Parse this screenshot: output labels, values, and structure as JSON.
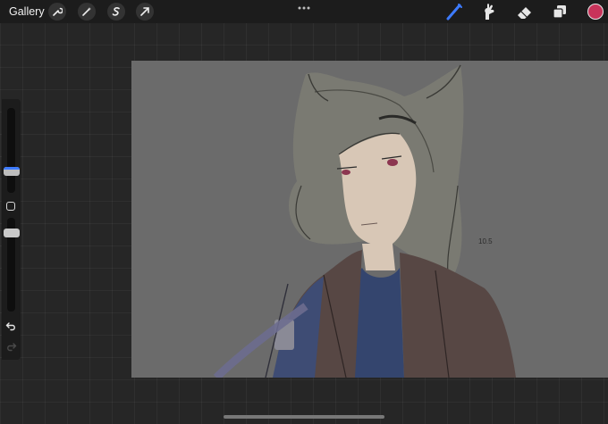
{
  "topbar": {
    "gallery_label": "Gallery",
    "left_tools": [
      "wrench-icon",
      "magic-wand-icon",
      "selection-icon",
      "transform-arrow-icon"
    ],
    "center_menu": "more-dots-icon",
    "right_tools": [
      "brush-icon",
      "smudge-icon",
      "eraser-icon",
      "layers-icon"
    ],
    "current_color": "#c8335a",
    "accent": "#3d7bff"
  },
  "sidebar": {
    "brush_size": 0.3,
    "opacity": 0.9,
    "tools": [
      "modify-square-icon",
      "undo-icon",
      "redo-icon"
    ]
  },
  "canvas": {
    "content": "sketch-artwork",
    "signature": "10.5"
  }
}
